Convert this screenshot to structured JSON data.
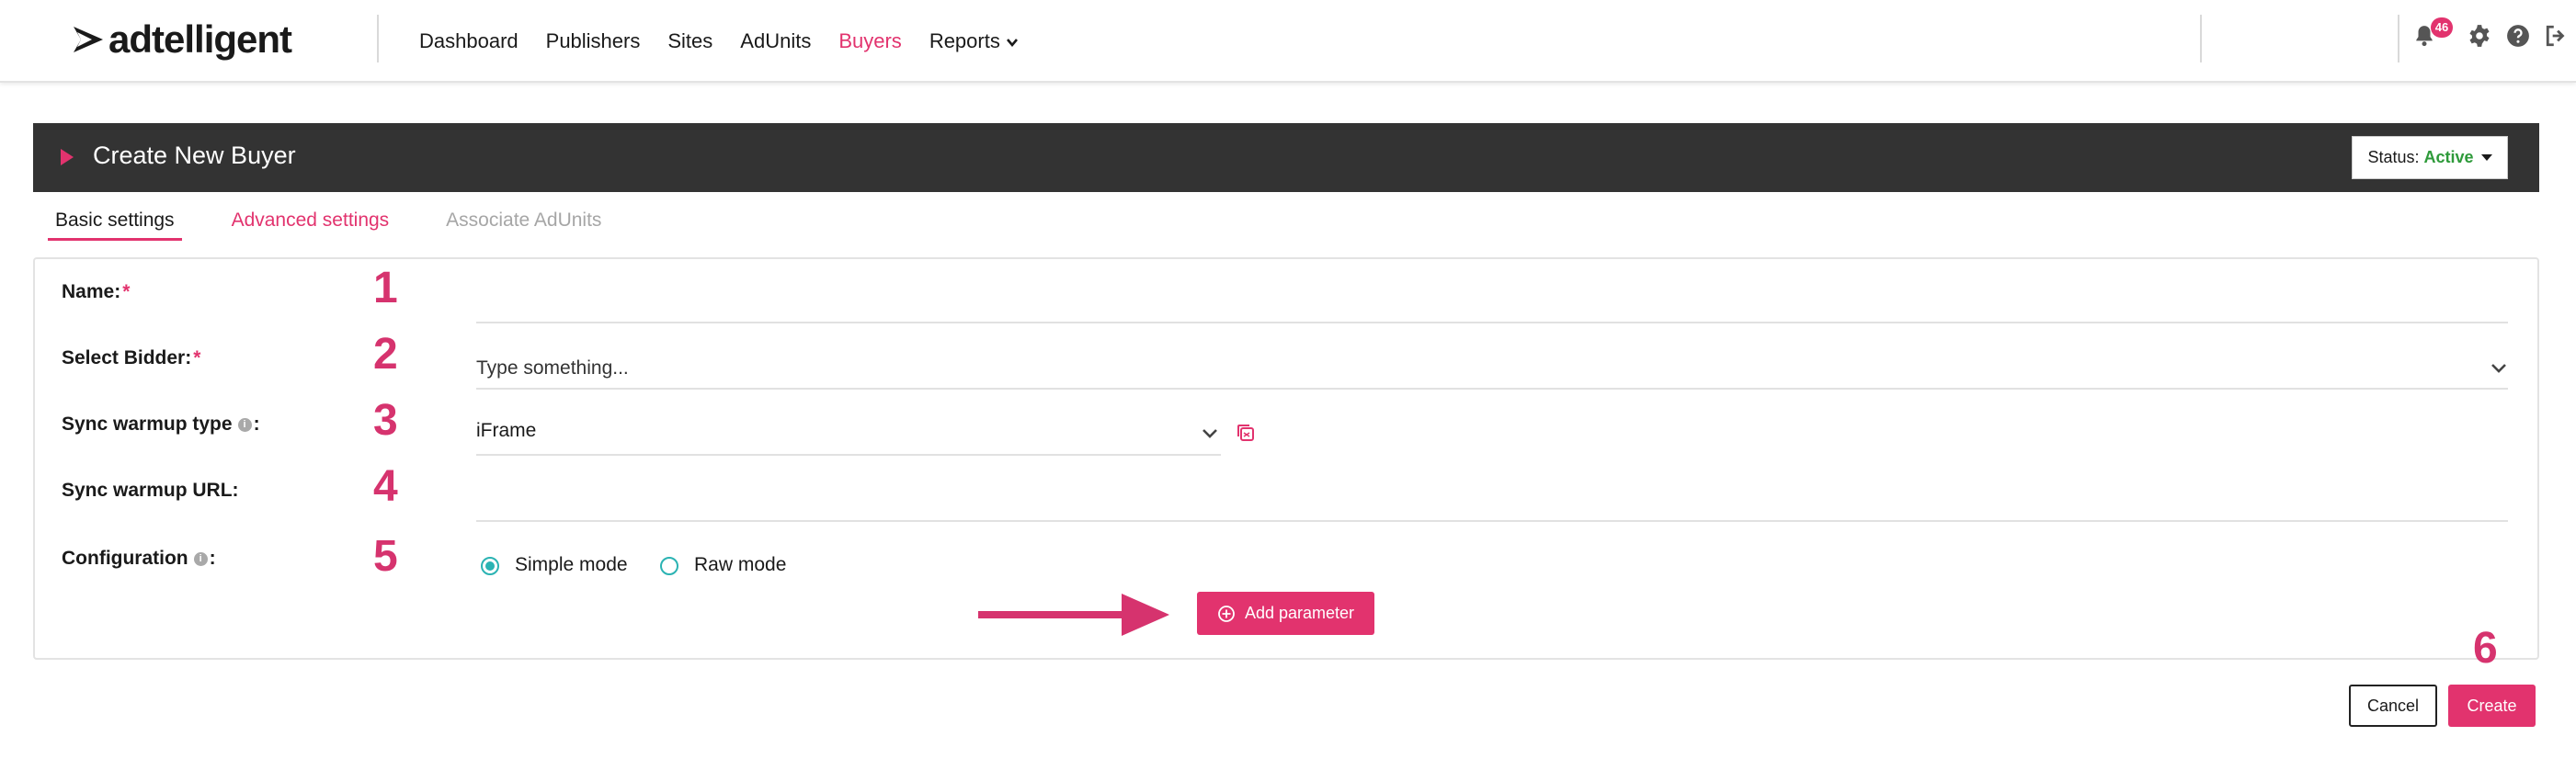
{
  "app": {
    "logo_text": "adtelligent"
  },
  "nav": {
    "items": [
      {
        "label": "Dashboard",
        "active": false
      },
      {
        "label": "Publishers",
        "active": false
      },
      {
        "label": "Sites",
        "active": false
      },
      {
        "label": "AdUnits",
        "active": false
      },
      {
        "label": "Buyers",
        "active": true
      },
      {
        "label": "Reports",
        "active": false,
        "has_dropdown": true
      }
    ],
    "notification_count": "46",
    "icons": [
      "bell-icon",
      "gear-icon",
      "help-icon",
      "logout-icon"
    ]
  },
  "header": {
    "title": "Create New Buyer",
    "status_label": "Status:",
    "status_value": "Active"
  },
  "tabs": [
    {
      "label": "Basic settings",
      "state": "active"
    },
    {
      "label": "Advanced settings",
      "state": "link"
    },
    {
      "label": "Associate AdUnits",
      "state": "disabled"
    }
  ],
  "form": {
    "name": {
      "label": "Name:",
      "required_mark": "*",
      "step": "1",
      "value": ""
    },
    "bidder": {
      "label": "Select Bidder: ",
      "required_mark": "*",
      "step": "2",
      "placeholder": "Type something..."
    },
    "sync_type": {
      "label": "Sync warmup type",
      "suffix": ":",
      "step": "3",
      "value": "iFrame"
    },
    "sync_url": {
      "label": "Sync warmup URL:",
      "step": "4",
      "value": ""
    },
    "configuration": {
      "label": "Configuration",
      "suffix": ":",
      "step": "5",
      "modes": [
        {
          "label": "Simple mode",
          "selected": true
        },
        {
          "label": "Raw mode",
          "selected": false
        }
      ]
    },
    "add_parameter_label": "Add parameter"
  },
  "footer": {
    "step": "6",
    "cancel_label": "Cancel",
    "create_label": "Create"
  },
  "colors": {
    "accent": "#e2336e",
    "header_bg": "#333333",
    "status_active": "#2e9a3a",
    "radio": "#2bb3b3"
  }
}
